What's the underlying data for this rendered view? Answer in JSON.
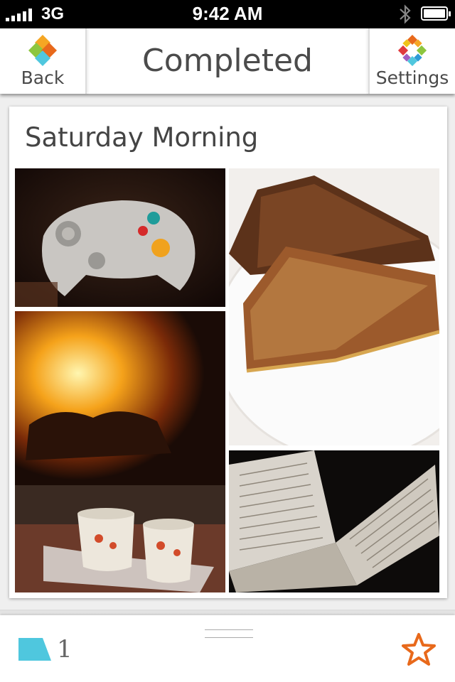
{
  "status_bar": {
    "carrier": "3G",
    "time": "9:42 AM",
    "bluetooth_icon": "bluetooth-icon",
    "battery_icon": "battery-icon"
  },
  "nav": {
    "title": "Completed",
    "back": {
      "label": "Back",
      "icon": "diamond-logo-icon"
    },
    "settings": {
      "label": "Settings",
      "icon": "pinwheel-icon"
    }
  },
  "card": {
    "title": "Saturday Morning",
    "photos": [
      {
        "name": "game-controller-photo",
        "subject": "game controller"
      },
      {
        "name": "grilled-cheese-photo",
        "subject": "grilled cheese sandwich"
      },
      {
        "name": "fireplace-mugs-photo",
        "subject": "fireplace with mugs"
      },
      {
        "name": "open-book-photo",
        "subject": "open book"
      }
    ]
  },
  "toolbar": {
    "comment_count": "1",
    "comment_icon": "comment-flag-icon",
    "favorite_icon": "star-icon"
  },
  "colors": {
    "accent_orange": "#e8691b",
    "accent_cyan": "#4fc7de",
    "text_gray": "#4b4b4b"
  }
}
